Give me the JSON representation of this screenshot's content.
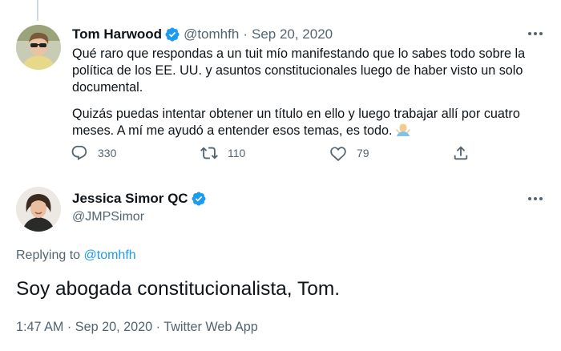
{
  "tweet": {
    "author_name": "Tom Harwood",
    "handle": "@tomhfh",
    "separator": "·",
    "date": "Sep 20, 2020",
    "paragraph_1": "Qué raro que respondas a un tuit mío manifestando que lo sabes todo sobre la política de los EE. UU. y asuntos constitucionales luego de haber visto un solo documental.",
    "paragraph_2": "Quizás puedas intentar obtener un título en ello y luego trabajar allí por cuatro meses. A mí  me ayudó a entender esos temas, es todo.",
    "emoji": "man-shrugging-emoji",
    "replies": "330",
    "retweets": "110",
    "likes": "79",
    "icons": {
      "reply": "reply-icon",
      "retweet": "retweet-icon",
      "like": "heart-icon",
      "share": "share-icon",
      "verified": "verified-badge-icon",
      "more": "more-icon"
    }
  },
  "reply": {
    "author_name": "Jessica Simor QC",
    "handle": "@JMPSimor",
    "replying_prefix": "Replying to",
    "replying_to": "@tomhfh",
    "text": "Soy abogada constitucionalista, Tom.",
    "time": "1:47 AM",
    "separator": "·",
    "date": "Sep 20, 2020",
    "separator_2": "·",
    "client": "Twitter Web App"
  },
  "colors": {
    "accent": "#1d9bf0",
    "text": "#0f1419",
    "muted": "#536471",
    "thread_line": "#cfd9de"
  }
}
